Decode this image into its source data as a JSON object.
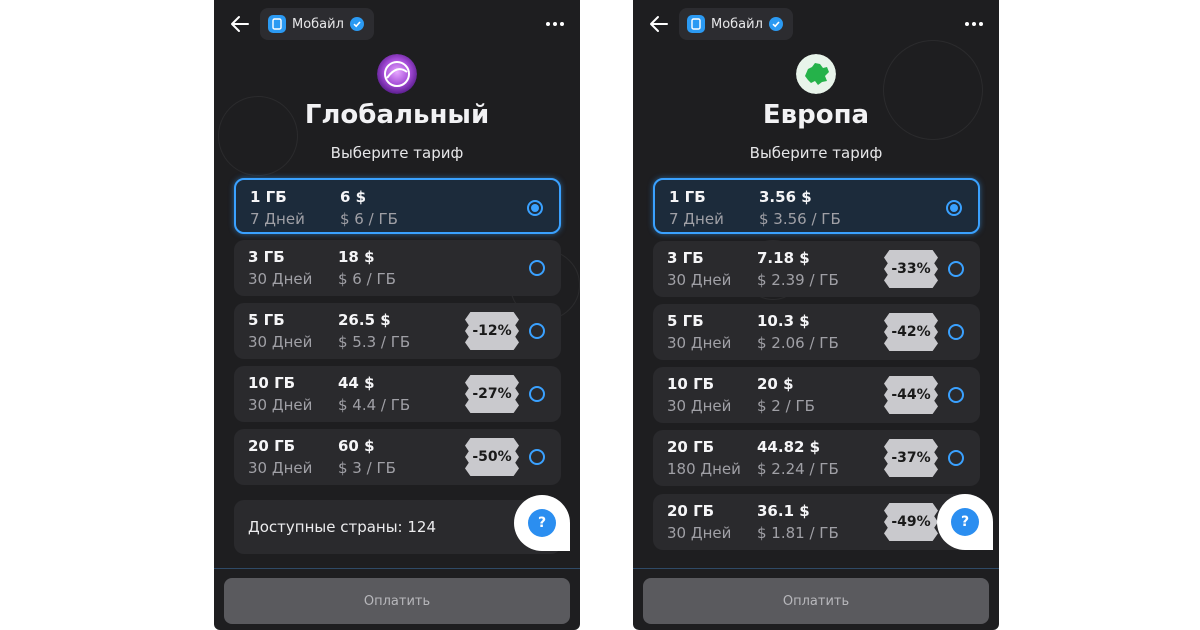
{
  "screens": [
    {
      "chip_label": "Мобайл",
      "region": "Глобальный",
      "subtitle": "Выберите тариф",
      "plans": [
        {
          "gb": "1 ГБ",
          "days": "7 Дней",
          "price": "6 $",
          "per_unit": "$ 6 / ГБ",
          "discount": "",
          "selected": true
        },
        {
          "gb": "3 ГБ",
          "days": "30 Дней",
          "price": "18 $",
          "per_unit": "$ 6 / ГБ",
          "discount": "",
          "selected": false
        },
        {
          "gb": "5 ГБ",
          "days": "30 Дней",
          "price": "26.5 $",
          "per_unit": "$ 5.3 / ГБ",
          "discount": "-12%",
          "selected": false
        },
        {
          "gb": "10 ГБ",
          "days": "30 Дней",
          "price": "44 $",
          "per_unit": "$ 4.4 / ГБ",
          "discount": "-27%",
          "selected": false
        },
        {
          "gb": "20 ГБ",
          "days": "30 Дней",
          "price": "60 $",
          "per_unit": "$ 3 / ГБ",
          "discount": "-50%",
          "selected": false
        }
      ],
      "countries_label": "Доступные страны: 124",
      "help_label": "?",
      "pay_label": "Оплатить"
    },
    {
      "chip_label": "Мобайл",
      "region": "Европа",
      "subtitle": "Выберите тариф",
      "plans": [
        {
          "gb": "1 ГБ",
          "days": "7 Дней",
          "price": "3.56 $",
          "per_unit": "$ 3.56 / ГБ",
          "discount": "",
          "selected": true
        },
        {
          "gb": "3 ГБ",
          "days": "30 Дней",
          "price": "7.18 $",
          "per_unit": "$ 2.39 / ГБ",
          "discount": "-33%",
          "selected": false
        },
        {
          "gb": "5 ГБ",
          "days": "30 Дней",
          "price": "10.3 $",
          "per_unit": "$ 2.06 / ГБ",
          "discount": "-42%",
          "selected": false
        },
        {
          "gb": "10 ГБ",
          "days": "30 Дней",
          "price": "20 $",
          "per_unit": "$ 2 / ГБ",
          "discount": "-44%",
          "selected": false
        },
        {
          "gb": "20 ГБ",
          "days": "180 Дней",
          "price": "44.82 $",
          "per_unit": "$ 2.24 / ГБ",
          "discount": "-37%",
          "selected": false
        },
        {
          "gb": "20 ГБ",
          "days": "30 Дней",
          "price": "36.1 $",
          "per_unit": "$ 1.81 / ГБ",
          "discount": "-49%",
          "selected": false
        }
      ],
      "help_label": "?",
      "pay_label": "Оплатить"
    }
  ],
  "colors": {
    "accent": "#3aa1ff",
    "background": "#1e1e20",
    "card": "#2a2a2d",
    "badge": "#c9c9cd",
    "help_button": "#2b8ef0",
    "pay_button": "#5a5a5e"
  },
  "icons": [
    "back-arrow-icon",
    "app-icon",
    "verified-badge-icon",
    "more-dots-icon",
    "globe-flag-icon",
    "europe-flag-icon",
    "help-icon"
  ]
}
